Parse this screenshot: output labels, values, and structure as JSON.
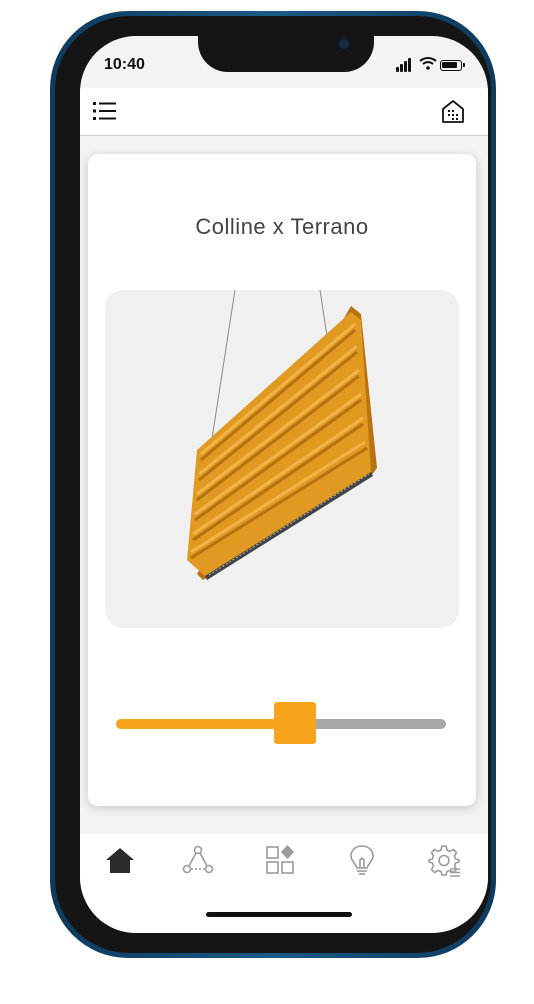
{
  "status_bar": {
    "time": "10:40",
    "icons": [
      "signal-icon",
      "wifi-icon",
      "battery-icon"
    ]
  },
  "header": {
    "left_icon": "menu-list-icon",
    "right_icon": "home-building-icon"
  },
  "card": {
    "title": "Colline x Terrano",
    "image": "suspended-orange-acoustic-panel-light"
  },
  "slider": {
    "value_fraction": 0.55,
    "fill_color": "#f5a41c",
    "track_color": "#a8a8a8"
  },
  "tab_bar": {
    "tabs": [
      {
        "icon": "home-icon",
        "active": true
      },
      {
        "icon": "group-nodes-icon",
        "active": false
      },
      {
        "icon": "scenes-grid-icon",
        "active": false
      },
      {
        "icon": "lightbulb-icon",
        "active": false
      },
      {
        "icon": "settings-gear-icon",
        "active": false
      }
    ]
  },
  "colors": {
    "accent": "#f5a41c",
    "frame": "#1a5a86",
    "active_icon": "#2b2b2b",
    "inactive_icon": "#9a9a9a"
  }
}
